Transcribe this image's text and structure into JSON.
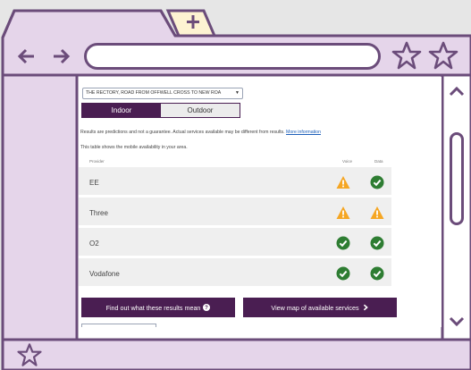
{
  "browser": {
    "new_tab_icon": "plus-icon",
    "nav_icons": [
      "arrow-left-icon",
      "arrow-right-icon"
    ],
    "bookmark_icons": [
      "star-icon",
      "star-icon"
    ],
    "address": "",
    "colors": {
      "frame": "#e5d5ea",
      "outline": "#6b4c7a",
      "tab": "#fdf3d2",
      "content": "#ffffff"
    }
  },
  "page": {
    "address_select": "THE RECTORY, ROAD FROM OFFWELL CROSS TO NEW ROA",
    "tabs": {
      "indoor": "Indoor",
      "outdoor": "Outdoor",
      "selected": "Indoor"
    },
    "disclaimer": "Results are predictions and not a guarantee. Actual services available may be different from results.",
    "more_info_link": "More information",
    "table_intro": "This table shows the mobile availability in your area.",
    "columns": {
      "provider": "Provider",
      "voice": "Voice",
      "data": "Data"
    },
    "providers": [
      {
        "name": "EE",
        "voice": "warning",
        "data": "ok"
      },
      {
        "name": "Three",
        "voice": "warning",
        "data": "warning"
      },
      {
        "name": "O2",
        "voice": "ok",
        "data": "ok"
      },
      {
        "name": "Vodafone",
        "voice": "ok",
        "data": "ok"
      }
    ],
    "buttons": {
      "results_meaning": "Find out what these results mean",
      "map": "View map of available services"
    },
    "colors": {
      "brand": "#4a1e52",
      "ok": "#2e7d32",
      "warning": "#f5a623",
      "link": "#1d5fb8"
    }
  }
}
